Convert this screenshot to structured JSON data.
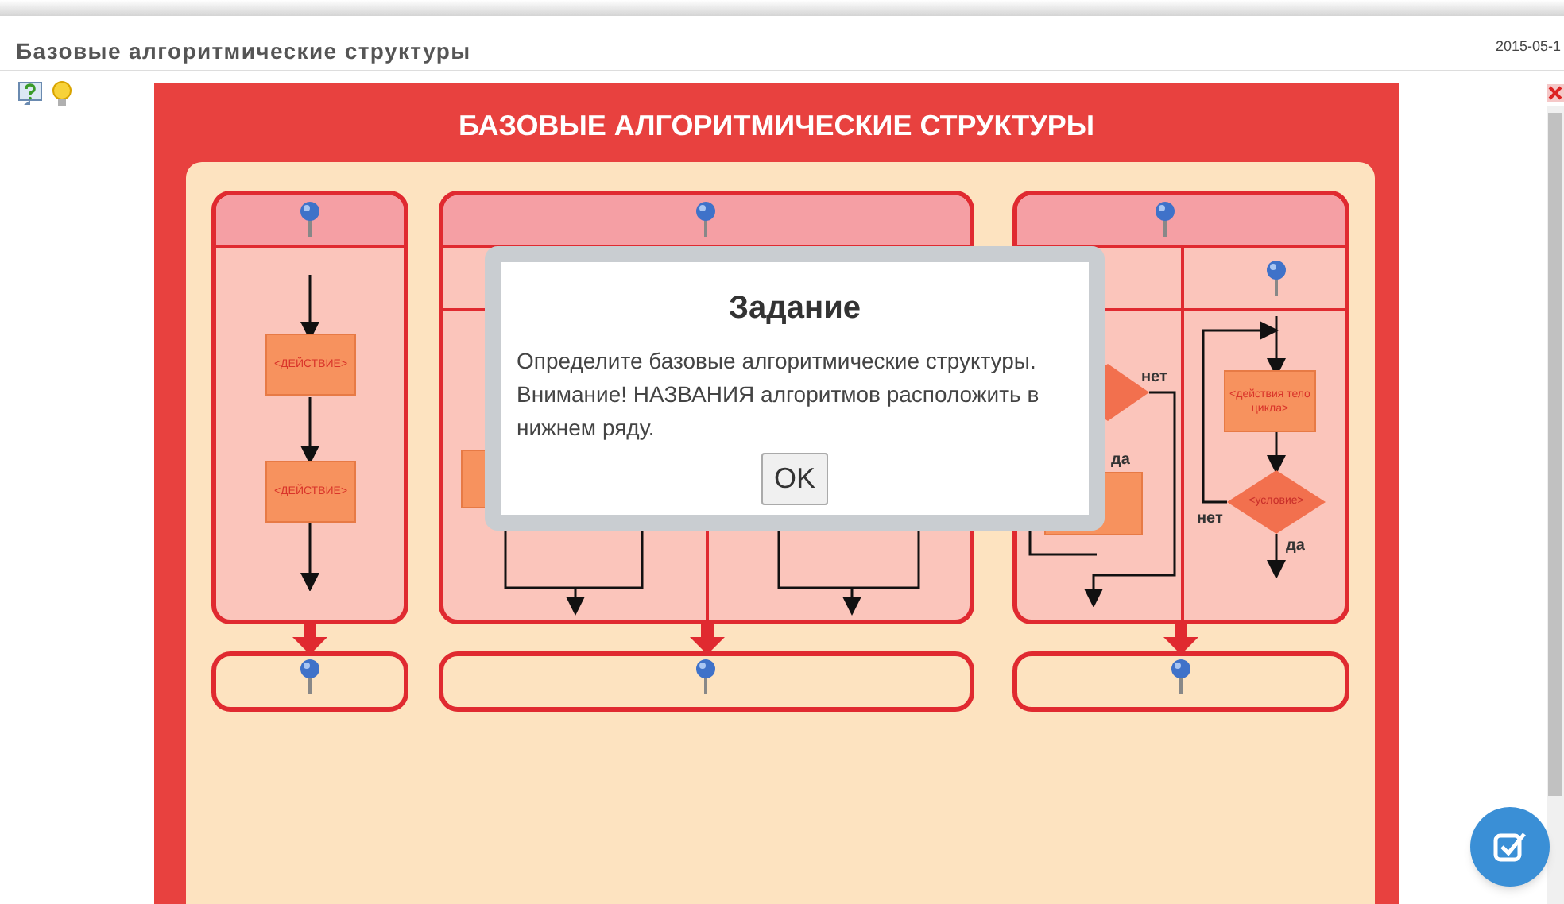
{
  "header": {
    "title": "Базовые алгоритмические структуры",
    "date": "2015-05-1"
  },
  "poster": {
    "title": "БАЗОВЫЕ АЛГОРИТМИЧЕСКИЕ СТРУКТУРЫ",
    "panels": [
      {
        "kind": "linear",
        "blocks": [
          "<ДЕЙСТВИЕ>",
          "<ДЕЙСТВИЕ>"
        ]
      },
      {
        "kind": "branching"
      },
      {
        "kind": "loops",
        "pre_no": "нет",
        "pre_yes": "да",
        "body": "<действия тело цикла>",
        "condition": "<условие>",
        "post_no": "нет",
        "post_yes": "да"
      }
    ]
  },
  "dialog": {
    "title": "Задание",
    "message": "Определите базовые алгоритмические структуры. Внимание! НАЗВАНИЯ алгоритмов расположить в нижнем ряду.",
    "button": "OK"
  }
}
